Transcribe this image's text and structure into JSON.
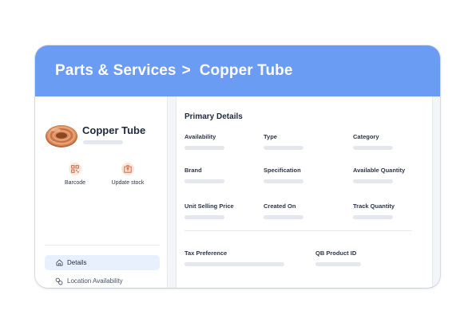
{
  "header": {
    "breadcrumb_root": "Parts & Services",
    "separator": ">",
    "breadcrumb_current": "Copper Tube",
    "color": "#6b9cf4"
  },
  "sidebar": {
    "product_name": "Copper Tube",
    "product_icon": "copper-coil-image",
    "actions": [
      {
        "label": "Barcode",
        "icon": "barcode-icon"
      },
      {
        "label": "Update stock",
        "icon": "update-stock-icon"
      }
    ],
    "nav": [
      {
        "label": "Details",
        "icon": "home-icon",
        "active": true
      },
      {
        "label": "Location Availability",
        "icon": "location-icon",
        "active": false
      }
    ]
  },
  "main": {
    "section_title": "Primary Details",
    "fields": [
      {
        "label": "Availability"
      },
      {
        "label": "Type"
      },
      {
        "label": "Category"
      },
      {
        "label": "Brand"
      },
      {
        "label": "Specification"
      },
      {
        "label": "Available Quantity"
      },
      {
        "label": "Unit Selling Price"
      },
      {
        "label": "Created On"
      },
      {
        "label": "Track Quantity"
      },
      {
        "label": "Tax Preference"
      },
      {
        "label": "QB Product ID"
      }
    ]
  },
  "colors": {
    "accent": "#6b9cf4",
    "active_nav_bg": "#e8f0fd",
    "icon_bg": "#fde6dc",
    "icon_fg": "#d0673f",
    "copper": "#c8774b"
  }
}
